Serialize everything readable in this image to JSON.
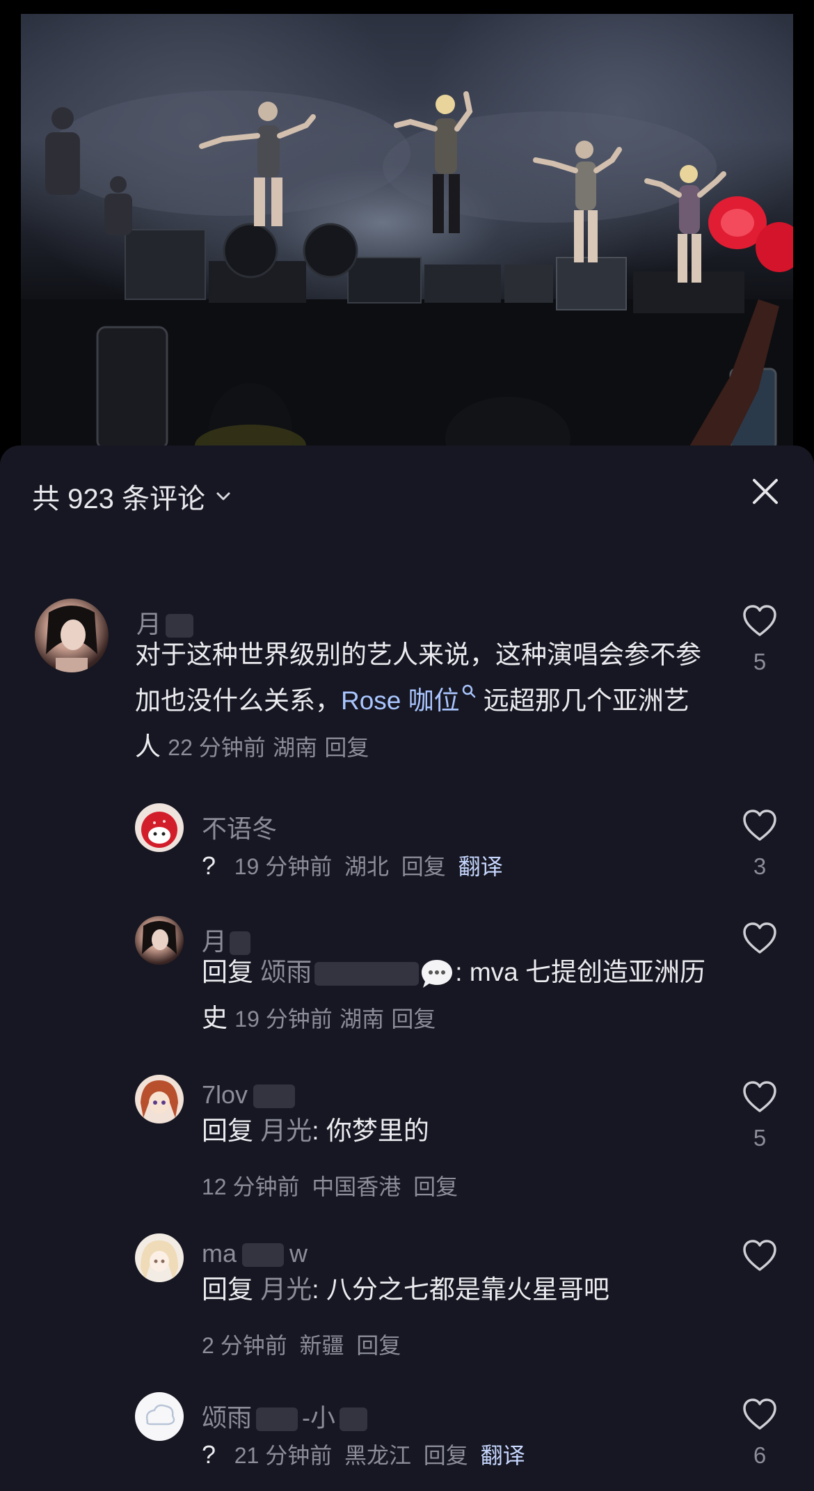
{
  "header": {
    "title": "共 923 条评论"
  },
  "comments": [
    {
      "user": "月",
      "text_before_link": "对于这种世界级别的艺人来说，这种演唱会参不参加也没什么关系，",
      "link": "Rose 咖位",
      "text_after_link": " 远超那几个亚洲艺人",
      "time": "22 分钟前",
      "location": "湖南",
      "reply": "回复",
      "likes": "5"
    },
    {
      "user": "不语冬",
      "text": "?",
      "time": "19 分钟前",
      "location": "湖北",
      "reply": "回复",
      "translate": "翻译",
      "likes": "3"
    },
    {
      "user": "月",
      "reply_prefix": "回复",
      "reply_to": "颂雨",
      "text": ": mva 七提创造亚洲历史",
      "time": "19 分钟前",
      "location": "湖南",
      "reply": "回复",
      "likes": ""
    },
    {
      "user": "7lov",
      "reply_prefix": "回复",
      "reply_to": "月光",
      "text": ": 你梦里的",
      "time": "12 分钟前",
      "location": "中国香港",
      "reply": "回复",
      "likes": "5"
    },
    {
      "user": "ma",
      "user_tail": "w",
      "reply_prefix": "回复",
      "reply_to": "月光",
      "text": ": 八分之七都是靠火星哥吧",
      "time": "2 分钟前",
      "location": "新疆",
      "reply": "回复",
      "likes": ""
    },
    {
      "user": "颂雨",
      "user_tail": "-小",
      "text": "?",
      "time": "21 分钟前",
      "location": "黑龙江",
      "reply": "回复",
      "translate": "翻译",
      "likes": "6"
    }
  ],
  "icons": {
    "close": "close-icon",
    "chevron": "chevron-down-icon",
    "heart": "heart-outline-icon",
    "bubble": "speech-bubble-icon"
  },
  "colors": {
    "sheet_bg": "#161722",
    "secondary_text": "#8c8d99",
    "link": "#aac6ff"
  }
}
